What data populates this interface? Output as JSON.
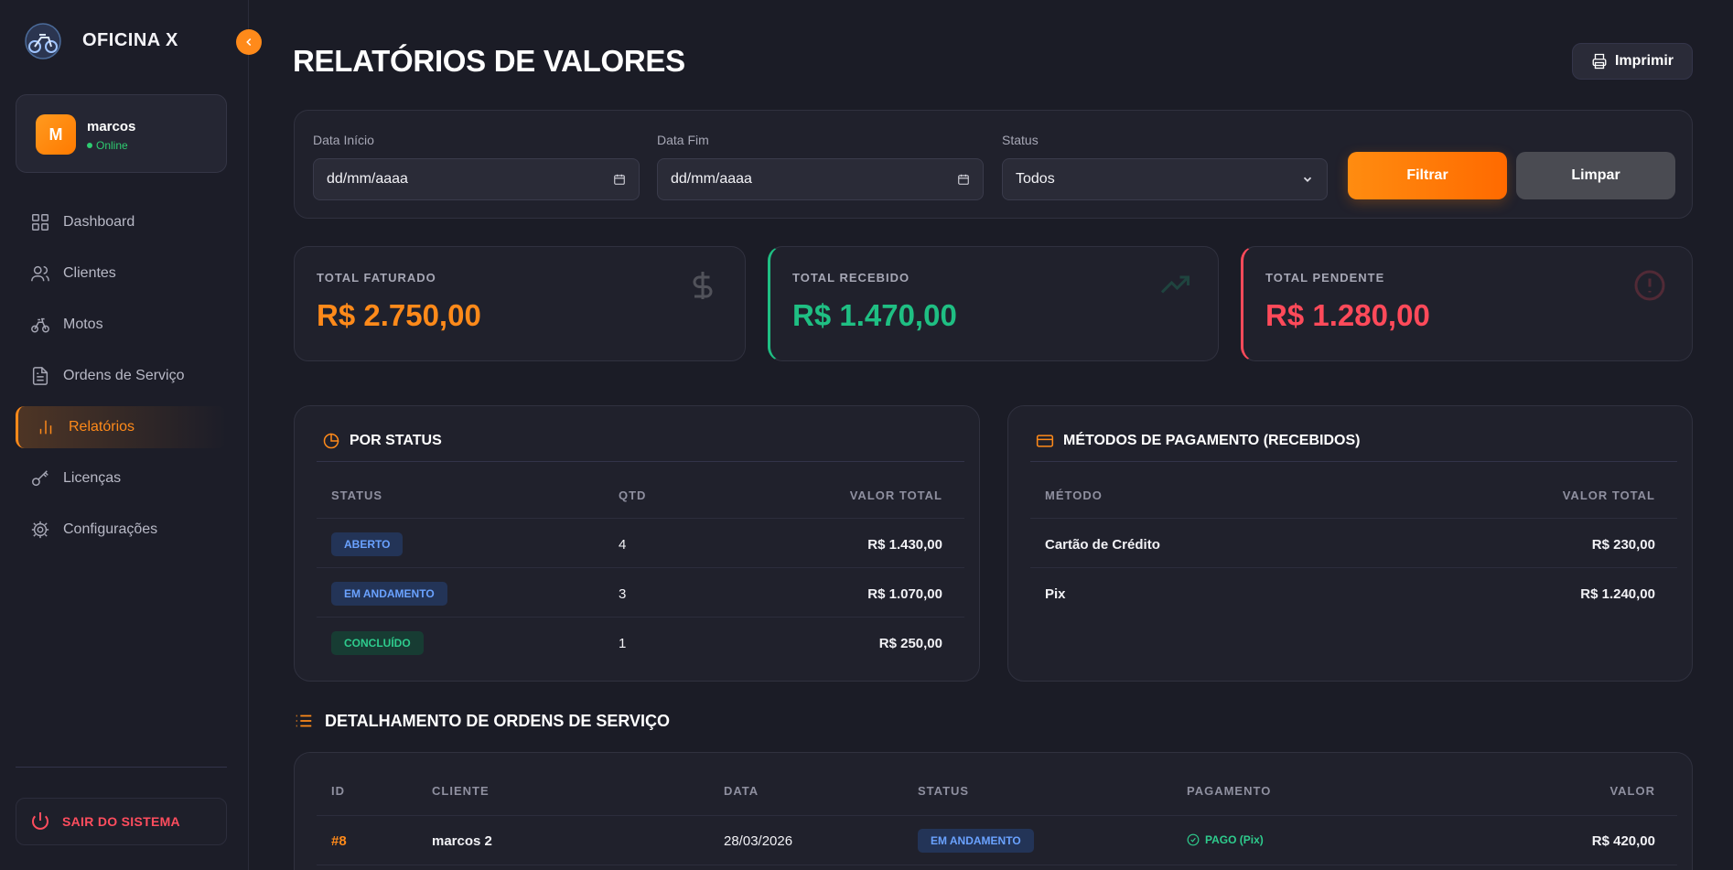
{
  "app": {
    "brand": "OFICINA X"
  },
  "user": {
    "initial": "M",
    "name": "marcos",
    "status": "Online"
  },
  "nav": [
    {
      "label": "Dashboard",
      "icon": "grid-icon"
    },
    {
      "label": "Clientes",
      "icon": "users-icon"
    },
    {
      "label": "Motos",
      "icon": "bike-icon"
    },
    {
      "label": "Ordens de Serviço",
      "icon": "document-icon"
    },
    {
      "label": "Relatórios",
      "icon": "bar-chart-icon",
      "active": true
    },
    {
      "label": "Licenças",
      "icon": "key-icon"
    },
    {
      "label": "Configurações",
      "icon": "gear-icon"
    }
  ],
  "logout_label": "SAIR DO SISTEMA",
  "page": {
    "title": "RELATÓRIOS DE VALORES",
    "print_label": "Imprimir"
  },
  "filters": {
    "start_label": "Data Início",
    "start_value": "dd/mm/aaaa",
    "end_label": "Data Fim",
    "end_value": "dd/mm/aaaa",
    "status_label": "Status",
    "status_value": "Todos",
    "filter_button": "Filtrar",
    "clear_button": "Limpar"
  },
  "stats": [
    {
      "label": "TOTAL FATURADO",
      "value": "R$ 2.750,00",
      "color": "#ff8a1a",
      "icon": "dollar-icon"
    },
    {
      "label": "TOTAL RECEBIDO",
      "value": "R$ 1.470,00",
      "color": "#1fbf83",
      "icon": "trending-up-icon"
    },
    {
      "label": "TOTAL PENDENTE",
      "value": "R$ 1.280,00",
      "color": "#ff4a5a",
      "icon": "alert-circle-icon"
    }
  ],
  "by_status": {
    "title": "POR STATUS",
    "headers": [
      "STATUS",
      "QTD",
      "VALOR TOTAL"
    ],
    "rows": [
      {
        "status": "ABERTO",
        "qty": "4",
        "total": "R$ 1.430,00"
      },
      {
        "status": "EM ANDAMENTO",
        "qty": "3",
        "total": "R$ 1.070,00"
      },
      {
        "status": "CONCLUÍDO",
        "qty": "1",
        "total": "R$ 250,00"
      }
    ]
  },
  "payment_methods": {
    "title": "MÉTODOS DE PAGAMENTO (RECEBIDOS)",
    "headers": [
      "MÉTODO",
      "VALOR TOTAL"
    ],
    "rows": [
      {
        "method": "Cartão de Crédito",
        "total": "R$ 230,00"
      },
      {
        "method": "Pix",
        "total": "R$ 1.240,00"
      }
    ]
  },
  "details": {
    "title": "DETALHAMENTO DE ORDENS DE SERVIÇO",
    "headers": [
      "ID",
      "CLIENTE",
      "DATA",
      "STATUS",
      "PAGAMENTO",
      "VALOR"
    ],
    "rows": [
      {
        "id": "#8",
        "client": "marcos 2",
        "date": "28/03/2026",
        "status": "EM ANDAMENTO",
        "payment": "PAGO (Pix)",
        "value": "R$ 420,00"
      }
    ]
  }
}
